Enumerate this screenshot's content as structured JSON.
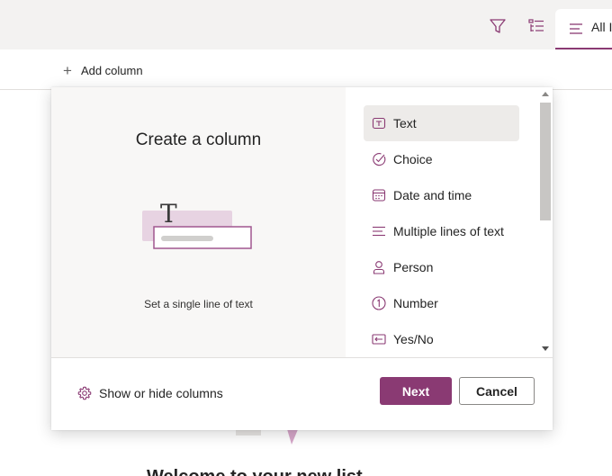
{
  "toolbar": {
    "filter_icon": "filter-icon",
    "groupby_icon": "group-by-icon",
    "view_label": "All I"
  },
  "add_column": {
    "icon": "plus-icon",
    "label": "Add column"
  },
  "welcome": {
    "text": "Welcome to your new list"
  },
  "dialog": {
    "title": "Create a column",
    "description": "Set a single line of text",
    "column_types": [
      {
        "label": "Text",
        "icon": "text-icon",
        "selected": true
      },
      {
        "label": "Choice",
        "icon": "choice-icon",
        "selected": false
      },
      {
        "label": "Date and time",
        "icon": "calendar-icon",
        "selected": false
      },
      {
        "label": "Multiple lines of text",
        "icon": "multiline-text-icon",
        "selected": false
      },
      {
        "label": "Person",
        "icon": "person-icon",
        "selected": false
      },
      {
        "label": "Number",
        "icon": "number-icon",
        "selected": false
      },
      {
        "label": "Yes/No",
        "icon": "yes-no-icon",
        "selected": false
      }
    ],
    "show_hide_label": "Show or hide columns",
    "next_label": "Next",
    "cancel_label": "Cancel"
  },
  "colors": {
    "accent": "#8a3a73",
    "selected_bg": "#edebe9",
    "pane_bg": "#f8f7f6",
    "toolbar_bg": "#f3f2f1"
  }
}
